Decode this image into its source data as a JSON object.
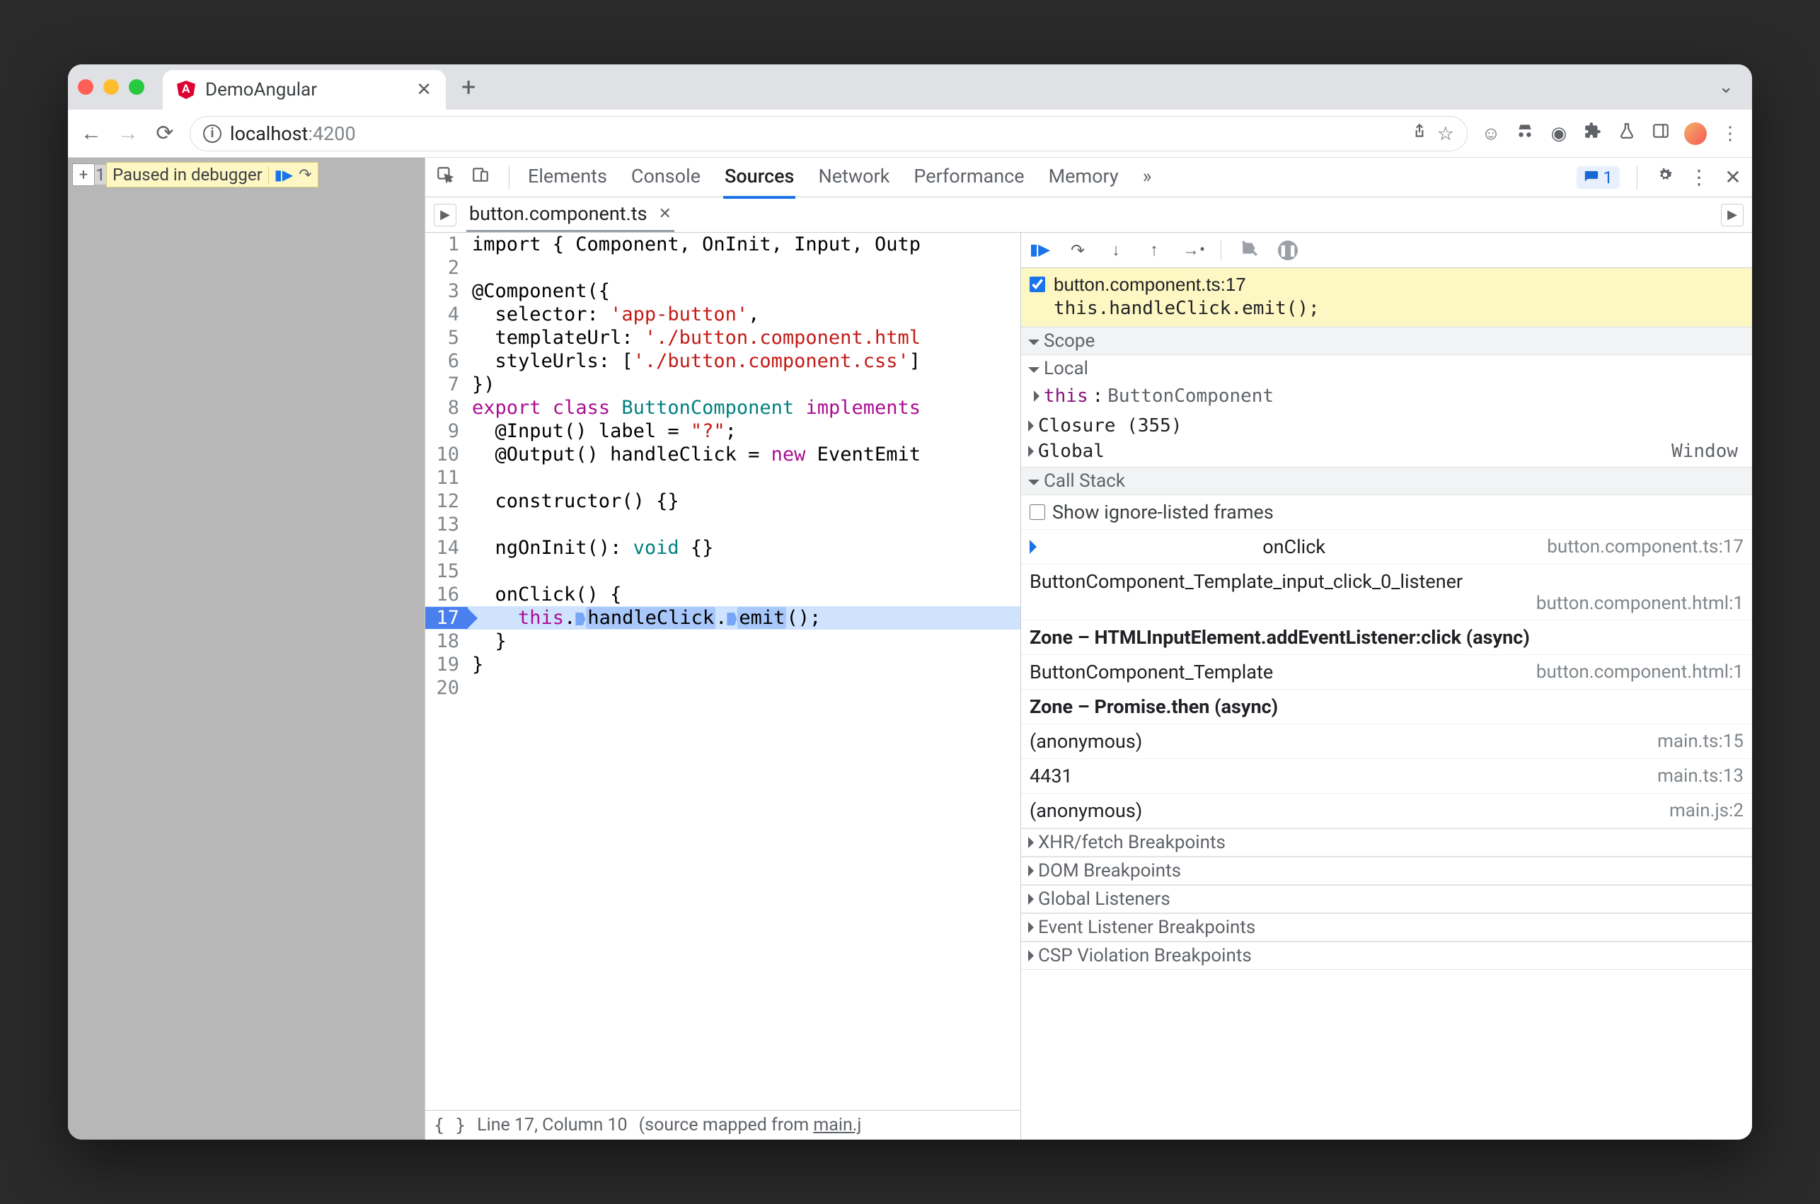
{
  "browser": {
    "tab_title": "DemoAngular",
    "url_host": "localhost",
    "url_port": ":4200"
  },
  "page_overlay": {
    "plus": "+",
    "badge_number": "1",
    "paused_label": "Paused in debugger"
  },
  "devtools": {
    "tabs": [
      "Elements",
      "Console",
      "Sources",
      "Network",
      "Performance",
      "Memory"
    ],
    "active_tab": "Sources",
    "more": "»",
    "issues_count": "1"
  },
  "file_tab": {
    "name": "button.component.ts"
  },
  "code": {
    "lines": [
      {
        "n": 1,
        "t": [
          "import { Component, OnInit, Input, Outp"
        ]
      },
      {
        "n": 2,
        "t": [
          ""
        ]
      },
      {
        "n": 3,
        "t": [
          "@Component({"
        ]
      },
      {
        "n": 4,
        "t": [
          "  selector: ",
          {
            "s": "'app-button'"
          },
          ","
        ]
      },
      {
        "n": 5,
        "t": [
          "  templateUrl: ",
          {
            "s": "'./button.component.html"
          }
        ]
      },
      {
        "n": 6,
        "t": [
          "  styleUrls: [",
          {
            "s": "'./button.component.css'"
          },
          "]"
        ]
      },
      {
        "n": 7,
        "t": [
          "})"
        ]
      },
      {
        "n": 8,
        "t": [
          {
            "k": "export"
          },
          " ",
          {
            "k": "class"
          },
          " ",
          {
            "ty": "ButtonComponent"
          },
          " ",
          {
            "k": "implements"
          }
        ]
      },
      {
        "n": 9,
        "t": [
          "  @Input() label = ",
          {
            "s": "\"?\""
          },
          ";"
        ]
      },
      {
        "n": 10,
        "t": [
          "  @Output() handleClick = ",
          {
            "k": "new"
          },
          " EventEmit"
        ]
      },
      {
        "n": 11,
        "t": [
          ""
        ]
      },
      {
        "n": 12,
        "t": [
          "  constructor() {}"
        ]
      },
      {
        "n": 13,
        "t": [
          ""
        ]
      },
      {
        "n": 14,
        "t": [
          "  ngOnInit(): ",
          {
            "ty": "void"
          },
          " {}"
        ]
      },
      {
        "n": 15,
        "t": [
          ""
        ]
      },
      {
        "n": 16,
        "t": [
          "  onClick() {"
        ]
      },
      {
        "n": 17,
        "hl": true,
        "t": [
          "    ",
          {
            "k": "this"
          },
          ".",
          {
            "m": ""
          },
          {
            "p": "handleClick"
          },
          ".",
          {
            "m": ""
          },
          {
            "p": "emit"
          },
          "();"
        ]
      },
      {
        "n": 18,
        "t": [
          "  }"
        ]
      },
      {
        "n": 19,
        "t": [
          "}"
        ]
      },
      {
        "n": 20,
        "t": [
          ""
        ]
      }
    ]
  },
  "status": {
    "line": "Line 17, Column 10",
    "mapped_prefix": "(source mapped from ",
    "mapped_link": "main.j"
  },
  "breakpoint": {
    "file": "button.component.ts:17",
    "expr": "this.handleClick.emit();"
  },
  "scope": {
    "header": "Scope",
    "local": "Local",
    "this_label": "this",
    "this_value": "ButtonComponent",
    "closure": "Closure (355)",
    "global": "Global",
    "global_value": "Window"
  },
  "callstack": {
    "header": "Call Stack",
    "show_ignore": "Show ignore-listed frames",
    "frames": [
      {
        "name": "onClick",
        "loc": "button.component.ts:17",
        "current": true
      },
      {
        "name": "ButtonComponent_Template_input_click_0_listener",
        "loc": "button.component.html:1",
        "twoLine": true
      },
      {
        "async": "Zone – HTMLInputElement.addEventListener:click (async)"
      },
      {
        "name": "ButtonComponent_Template",
        "loc": "button.component.html:1"
      },
      {
        "async": "Zone – Promise.then (async)"
      },
      {
        "name": "(anonymous)",
        "loc": "main.ts:15"
      },
      {
        "name": "4431",
        "loc": "main.ts:13"
      },
      {
        "name": "(anonymous)",
        "loc": "main.js:2"
      }
    ]
  },
  "extra_sections": [
    "XHR/fetch Breakpoints",
    "DOM Breakpoints",
    "Global Listeners",
    "Event Listener Breakpoints",
    "CSP Violation Breakpoints"
  ]
}
